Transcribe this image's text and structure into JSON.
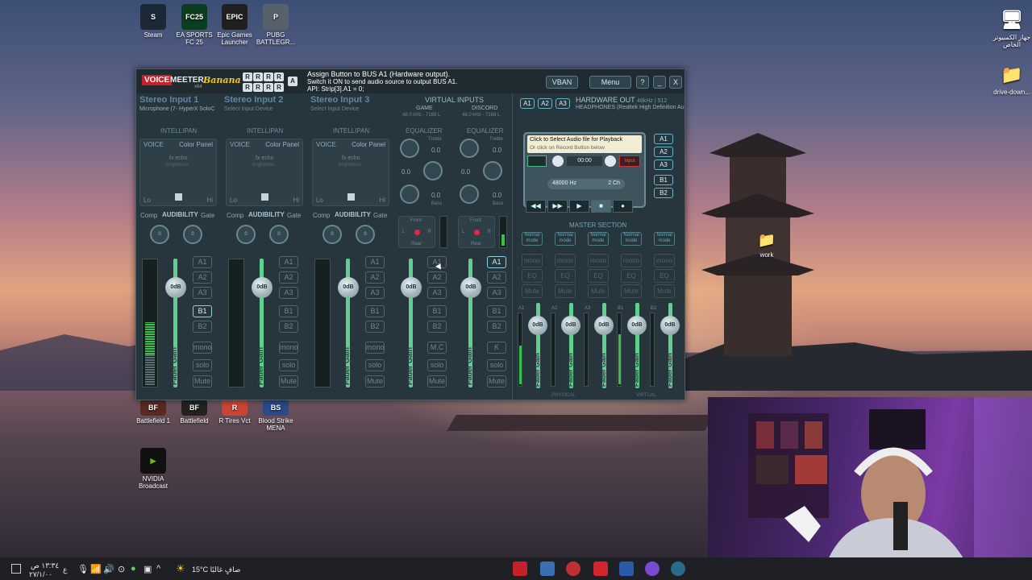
{
  "desktop_icons": [
    {
      "label": "Steam",
      "color": "#1b2838",
      "glyph": "S"
    },
    {
      "label": "EA SPORTS FC 25",
      "color": "#0b3d1f",
      "glyph": "FC25"
    },
    {
      "label": "Epic Games Launcher",
      "color": "#202020",
      "glyph": "EPIC"
    },
    {
      "label": "PUBG BATTLEGR...",
      "color": "#56616b",
      "glyph": "P"
    },
    {
      "label": "Battlefield 1",
      "color": "#5a2a20",
      "glyph": "BF"
    },
    {
      "label": "Battlefield",
      "color": "#222",
      "glyph": "BF"
    },
    {
      "label": "R Tires Vct",
      "color": "#c43",
      "glyph": "R"
    },
    {
      "label": "Blood Strike MENA",
      "color": "#2b4a8a",
      "glyph": "BS"
    },
    {
      "label": "NVIDIA Broadcast",
      "color": "#111",
      "glyph": "▶"
    }
  ],
  "right_icons": [
    {
      "label": "جهاز الكمبيوتر الخاص",
      "glyph": "🖥"
    },
    {
      "label": "drive-down...",
      "glyph": "📁"
    },
    {
      "label": "work",
      "glyph": "📁"
    }
  ],
  "voicemeeter": {
    "logo": {
      "voice": "VOICE",
      "meeter": "MEETER",
      "x64": "x64",
      "edition": "Banana"
    },
    "r_buttons": [
      "R",
      "R",
      "R",
      "R",
      "R",
      "R",
      "R",
      "R"
    ],
    "a_button": "A",
    "hint": {
      "line1": "Assign Button to BUS A1 (Hardware output).",
      "line2": "Switch it ON to send audio source to output BUS A1.",
      "line3": "API: Strip[3].A1 = 0;"
    },
    "buttons": {
      "vban": "VBAN",
      "menu": "Menu",
      "help": "?",
      "minimize": "_",
      "close": "X"
    },
    "hw_strips": [
      {
        "name": "Stereo Input 1",
        "device": "Microphone (7- HyperX SoloC",
        "dim": false,
        "bus_states": [
          false,
          false,
          false,
          true,
          false
        ]
      },
      {
        "name": "Stereo Input 2",
        "device": "Select Input Device",
        "dim": true,
        "bus_states": [
          false,
          false,
          false,
          false,
          false
        ]
      },
      {
        "name": "Stereo Input 3",
        "device": "Select Input Device",
        "dim": true,
        "bus_states": [
          false,
          false,
          false,
          false,
          false
        ]
      }
    ],
    "intellipan": "INTELLIPAN",
    "voice": "VOICE",
    "color_panel": "Color Panel",
    "fx_echo": "fx echo",
    "brightness": "brightness",
    "lo": "Lo",
    "hi": "Hi",
    "comp": "Comp",
    "audibility": "AUDIBILITY",
    "gate": "Gate",
    "knob_zero": "0",
    "virtual_inputs": {
      "title": "VIRTUAL INPUTS",
      "game": "GAME",
      "discord": "DISCORD",
      "game_rate": "48.0 kHz - 7168 L",
      "discord_rate": "48.0 kHz - 7168 L"
    },
    "equalizer": "EQUALIZER",
    "treble": "Treble",
    "bass": "Bass",
    "eq_value": "0.0",
    "front": "Front",
    "rear": "Rear",
    "l": "L",
    "r": "R",
    "bus_labels": [
      "A1",
      "A2",
      "A3",
      "B1",
      "B2"
    ],
    "mono": "mono",
    "solo": "solo",
    "mute": "Mute",
    "mc": "M.C",
    "k": "K",
    "fader_value": "0dB",
    "fader_label": "Fader Gain",
    "hardware_out": {
      "bus_a": [
        "A1",
        "A2",
        "A3"
      ],
      "title": "HARDWARE OUT",
      "rate": "48kHz | 512",
      "device": "HEADPHONES (Realtek High Definition Au"
    },
    "player": {
      "line1": "Click to Select Audio file for Playback",
      "line2": "Or click on Record Button below",
      "time": "00:00",
      "input": "input",
      "hz": "48000 Hz",
      "ch": "2 Ch",
      "controls": [
        "◀◀",
        "▶▶",
        "▶",
        "■",
        "●"
      ]
    },
    "rec_bus": [
      "A1",
      "A2",
      "A3",
      "B1",
      "B2"
    ],
    "master_section": "MASTER SECTION",
    "master_bus_labels": [
      "A1",
      "A2",
      "A3",
      "B1",
      "B2"
    ],
    "normal_mode": "Normal mode",
    "eq": "EQ",
    "physical": "PHYSICAL",
    "virtual": "VIRTUAL"
  },
  "taskbar": {
    "time": "١٣:٣٤ ص",
    "date": "٢٧/١/٠٠",
    "lang": "ع",
    "weather": "15°C صافٍ غالبًا"
  }
}
